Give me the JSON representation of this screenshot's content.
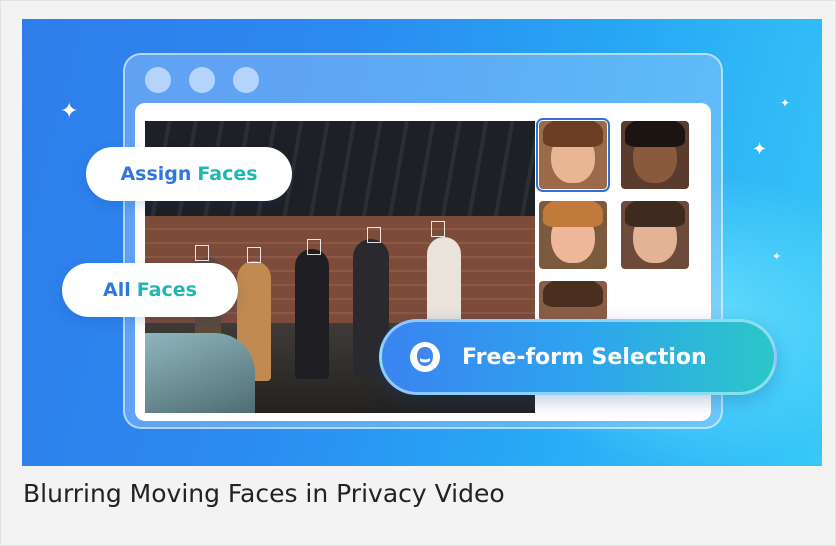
{
  "banner": {
    "pills": {
      "assign": {
        "word1": "Assign",
        "word2": "Faces"
      },
      "all": {
        "word1": "All",
        "word2": "Faces"
      }
    },
    "freeform_button": {
      "label": "Free-form Selection",
      "icon": "face-mask-icon"
    },
    "window": {
      "dots": 3
    },
    "face_thumbnails": [
      {
        "name": "girl-smiling",
        "selected": true
      },
      {
        "name": "boy-looking-down",
        "selected": false
      },
      {
        "name": "red-haired-boy",
        "selected": false
      },
      {
        "name": "girl-with-glasses",
        "selected": false
      },
      {
        "name": "partial-face",
        "selected": false
      }
    ]
  },
  "caption": "Blurring Moving Faces in Privacy Video",
  "colors": {
    "banner_blue": "#2b8af0",
    "accent_blue": "#2f77e0",
    "accent_teal": "#1fb7b0",
    "caption_text": "#222222"
  }
}
